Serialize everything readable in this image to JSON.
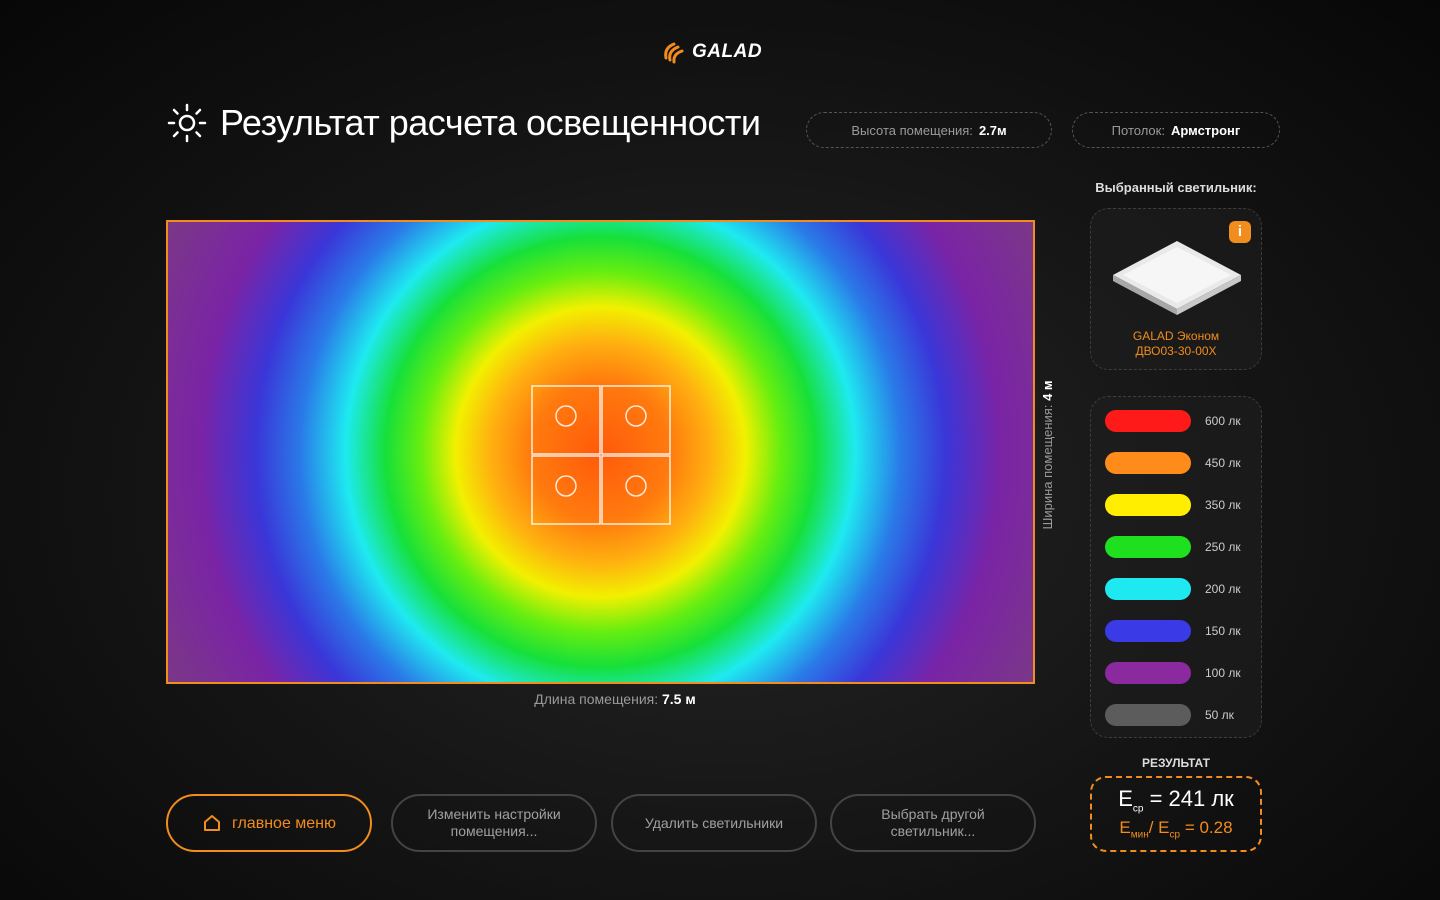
{
  "brand": {
    "name": "GALAD",
    "accent_color": "#f28c1c"
  },
  "header": {
    "title": "Результат расчета освещенности",
    "icon": "sun-icon",
    "room_height_label": "Высота помещения:",
    "room_height_value": "2.7м",
    "ceiling_label": "Потолок:",
    "ceiling_value": "Армстронг"
  },
  "plan": {
    "length_label": "Длина помещения:",
    "length_value": "7.5 м",
    "width_label": "Ширина помещения:",
    "width_value": "4 м",
    "fixtures_count": 4
  },
  "luminaire": {
    "section_label": "Выбранный светильник:",
    "name_line1": "GALAD Эконом",
    "name_line2": "ДВО03-30-00Х",
    "info_icon": "info-icon"
  },
  "legend": {
    "items": [
      {
        "value": "600 лк",
        "color": "#ff1a1a"
      },
      {
        "value": "450 лк",
        "color": "#ff8c1a"
      },
      {
        "value": "350 лк",
        "color": "#ffee00"
      },
      {
        "value": "250 лк",
        "color": "#1ee01e"
      },
      {
        "value": "200 лк",
        "color": "#1ee8f0"
      },
      {
        "value": "150 лк",
        "color": "#3a3ae6"
      },
      {
        "value": "100 лк",
        "color": "#8a2a9e"
      },
      {
        "value": "50 лк",
        "color": "#5c5c5c"
      }
    ]
  },
  "result": {
    "label": "РЕЗУЛЬТАТ",
    "e_avg_symbol": "E",
    "e_avg_sub": "ср",
    "e_avg_value": "= 241 лк",
    "ratio_e1": "E",
    "ratio_sub1": "мин",
    "ratio_sep": "/ E",
    "ratio_sub2": "ср",
    "ratio_value": "= 0.28"
  },
  "buttons": {
    "main_menu": "главное меню",
    "change_settings": "Изменить настройки помещения...",
    "remove_luminaires": "Удалить светильники",
    "choose_other": "Выбрать другой светильник..."
  }
}
